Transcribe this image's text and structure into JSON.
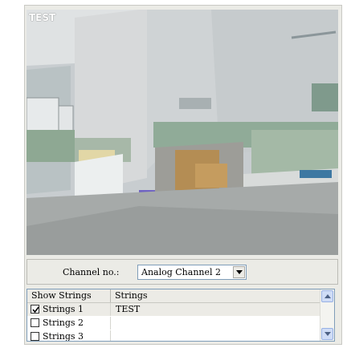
{
  "video": {
    "osd_title": "TEST"
  },
  "controls": {
    "channel_label": "Channel no.:",
    "channel_selected": "Analog Channel 2"
  },
  "grid": {
    "headers": [
      "Show Strings",
      "Strings"
    ],
    "rows": [
      {
        "label": "Strings 1",
        "checked": true,
        "value": "TEST"
      },
      {
        "label": "Strings 2",
        "checked": false,
        "value": ""
      },
      {
        "label": "Strings 3",
        "checked": false,
        "value": ""
      }
    ]
  },
  "icons": {
    "dropdown": "chevron-down-icon",
    "checkbox": "check-icon",
    "scroll_up": "scroll-up-icon",
    "scroll_down": "scroll-down-icon"
  }
}
